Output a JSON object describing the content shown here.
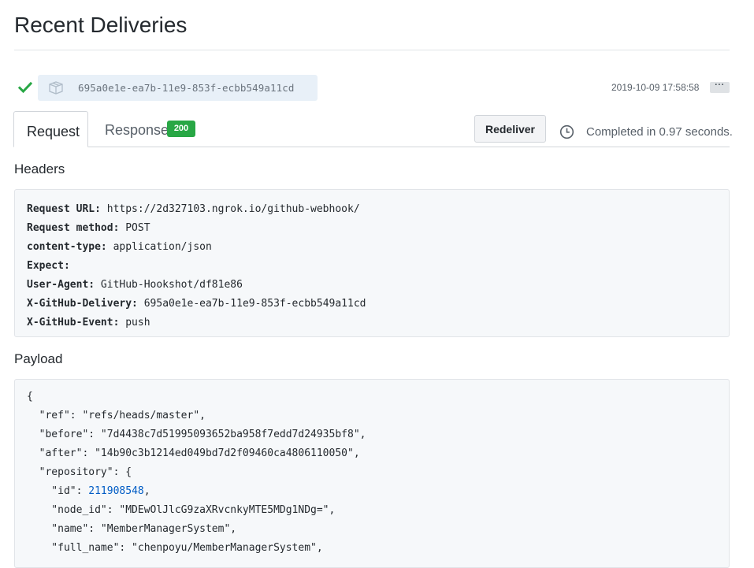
{
  "page": {
    "title": "Recent Deliveries"
  },
  "delivery": {
    "guid": "695a0e1e-ea7b-11e9-853f-ecbb549a11cd",
    "timestamp": "2019-10-09 17:58:58",
    "more_label": "···",
    "status_icon": "check-icon",
    "colors": {
      "success": "#28a745",
      "guid_bg": "#e8f0f8"
    }
  },
  "tabs": {
    "request_label": "Request",
    "response_label": "Response",
    "response_status": "200"
  },
  "actions": {
    "redeliver_label": "Redeliver",
    "completed_text": "Completed in 0.97 seconds."
  },
  "headers": {
    "heading": "Headers",
    "items": [
      {
        "key": "Request URL:",
        "value": " https://2d327103.ngrok.io/github-webhook/"
      },
      {
        "key": "Request method:",
        "value": " POST"
      },
      {
        "key": "content-type:",
        "value": " application/json"
      },
      {
        "key": "Expect:",
        "value": ""
      },
      {
        "key": "User-Agent:",
        "value": " GitHub-Hookshot/df81e86"
      },
      {
        "key": "X-GitHub-Delivery:",
        "value": " 695a0e1e-ea7b-11e9-853f-ecbb549a11cd"
      },
      {
        "key": "X-GitHub-Event:",
        "value": " push"
      }
    ]
  },
  "payload": {
    "heading": "Payload",
    "lines": [
      {
        "text": "{"
      },
      {
        "text": "  \"ref\": \"refs/heads/master\","
      },
      {
        "text": "  \"before\": \"7d4438c7d51995093652ba958f7edd7d24935bf8\","
      },
      {
        "text": "  \"after\": \"14b90c3b1214ed049bd7d2f09460ca4806110050\","
      },
      {
        "text": "  \"repository\": {"
      },
      {
        "prefix": "    \"id\": ",
        "number": "211908548",
        "suffix": ","
      },
      {
        "text": "    \"node_id\": \"MDEwOlJlcG9zaXRvcnkyMTE5MDg1NDg=\","
      },
      {
        "text": "    \"name\": \"MemberManagerSystem\","
      },
      {
        "text": "    \"full_name\": \"chenpoyu/MemberManagerSystem\","
      }
    ]
  }
}
